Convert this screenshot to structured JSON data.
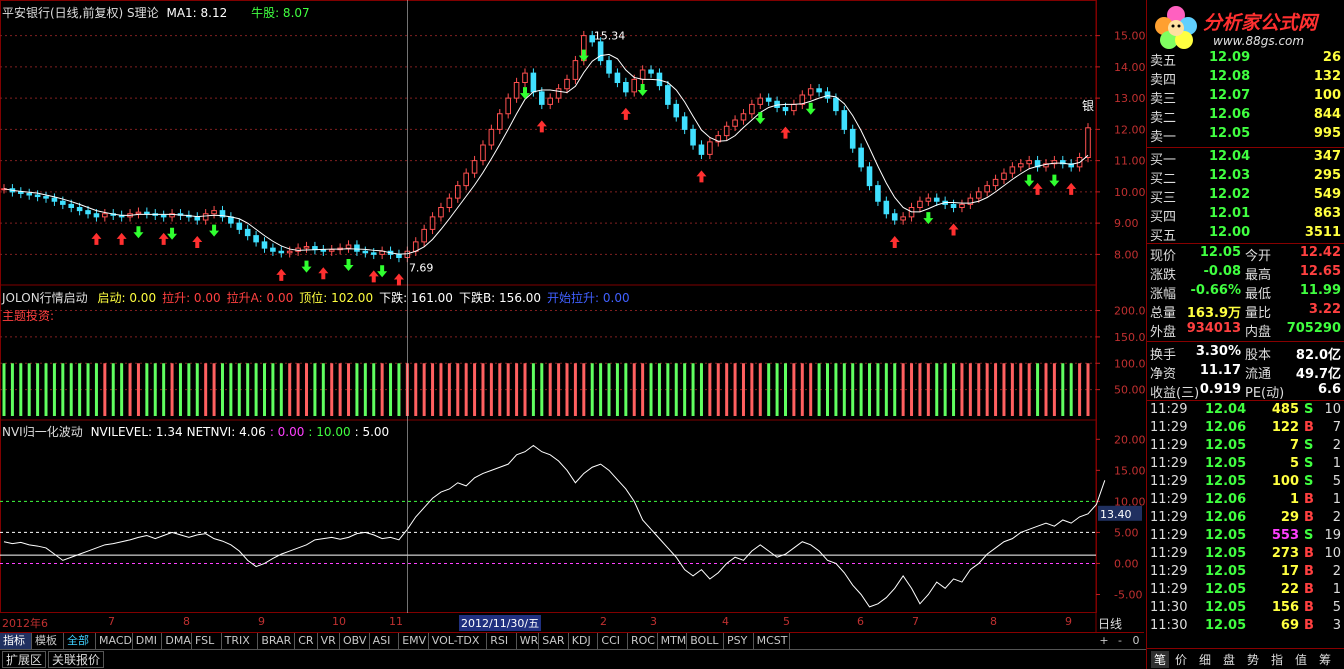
{
  "chart_header": {
    "stock": "平安银行(日线,前复权)",
    "indicator": "S理论",
    "ma_label": "MA1: 8.12",
    "bull_label": "牛股: 8.07",
    "high_label": "15.34",
    "low_label": "7.69",
    "sell_tag": "银"
  },
  "panel2_header": {
    "name": "JOLON行情启动",
    "items": [
      {
        "text": "启动: 0.00",
        "color": "#ffff40"
      },
      {
        "text": "拉升: 0.00",
        "color": "#ff4040"
      },
      {
        "text": "拉升A: 0.00",
        "color": "#ff4040"
      },
      {
        "text": "顶位: 102.00",
        "color": "#ffff40"
      },
      {
        "text": "下跌: 161.00",
        "color": "#ffffff"
      },
      {
        "text": "下跌B: 156.00",
        "color": "#ffffff"
      },
      {
        "text": "开始拉升: 0.00",
        "color": "#4060ff"
      }
    ],
    "sub": "主题投资:"
  },
  "panel3_header": {
    "name": "NVI归一化波动",
    "items": [
      {
        "text": "NVILEVEL: 1.34",
        "color": "#ffffff"
      },
      {
        "text": "NETNVI: 4.06",
        "color": "#ffffff"
      },
      {
        "text": ": 0.00",
        "color": "#ff40ff"
      },
      {
        "text": ": 10.00",
        "color": "#40ff40"
      },
      {
        "text": ": 5.00",
        "color": "#ffffff"
      }
    ],
    "current_value": "13.40"
  },
  "axis_labels": {
    "panel1": [
      "15.00",
      "14.00",
      "13.00",
      "12.00",
      "11.00",
      "10.00",
      "9.00",
      "8.00"
    ],
    "panel2": [
      "200.0",
      "150.0",
      "100.0",
      "50.00"
    ],
    "panel3": [
      "20.00",
      "15.00",
      "10.00",
      "5.00",
      "0.00",
      "-5.00"
    ]
  },
  "x_labels": [
    {
      "text": "2012年6",
      "type": "normal"
    },
    {
      "text": "7",
      "type": "normal"
    },
    {
      "text": "8",
      "type": "normal"
    },
    {
      "text": "9",
      "type": "normal"
    },
    {
      "text": "10",
      "type": "normal"
    },
    {
      "text": "11",
      "type": "normal"
    },
    {
      "text": "2012/11/30/五",
      "type": "cursor"
    },
    {
      "text": "2",
      "type": "normal"
    },
    {
      "text": "3",
      "type": "normal"
    },
    {
      "text": "4",
      "type": "normal"
    },
    {
      "text": "5",
      "type": "normal"
    },
    {
      "text": "6",
      "type": "normal"
    },
    {
      "text": "7",
      "type": "normal"
    },
    {
      "text": "8",
      "type": "normal"
    },
    {
      "text": "9",
      "type": "normal"
    }
  ],
  "period_label": "日线",
  "toolbar": [
    "指标",
    "模板",
    "全部",
    "MACD",
    "DMI",
    "DMA",
    "FSL",
    "TRIX",
    "BRAR",
    "CR",
    "VR",
    "OBV",
    "ASI",
    "EMV",
    "VOL-TDX",
    "RSI",
    "WR",
    "SAR",
    "KDJ",
    "CCI",
    "ROC",
    "MTM",
    "BOLL",
    "PSY",
    "MCST"
  ],
  "toolbar_right": [
    "+",
    "-",
    "0"
  ],
  "bottombar": [
    "扩展区",
    "关联报价"
  ],
  "logo": {
    "title": "分析家公式网",
    "url": "www.88gs.com"
  },
  "order_book": {
    "sell": [
      {
        "label": "卖五",
        "price": "12.09",
        "vol": "26"
      },
      {
        "label": "卖四",
        "price": "12.08",
        "vol": "132"
      },
      {
        "label": "卖三",
        "price": "12.07",
        "vol": "100"
      },
      {
        "label": "卖二",
        "price": "12.06",
        "vol": "844"
      },
      {
        "label": "卖一",
        "price": "12.05",
        "vol": "995"
      }
    ],
    "buy": [
      {
        "label": "买一",
        "price": "12.04",
        "vol": "347"
      },
      {
        "label": "买二",
        "price": "12.03",
        "vol": "295"
      },
      {
        "label": "买三",
        "price": "12.02",
        "vol": "549"
      },
      {
        "label": "买四",
        "price": "12.01",
        "vol": "863"
      },
      {
        "label": "买五",
        "price": "12.00",
        "vol": "3511"
      }
    ]
  },
  "quote": [
    {
      "l1": "现价",
      "v1": "12.05",
      "c1": "#40ff40",
      "l2": "今开",
      "v2": "12.42",
      "c2": "#ff4040"
    },
    {
      "l1": "涨跌",
      "v1": "-0.08",
      "c1": "#40ff40",
      "l2": "最高",
      "v2": "12.65",
      "c2": "#ff4040"
    },
    {
      "l1": "涨幅",
      "v1": "-0.66%",
      "c1": "#40ff40",
      "l2": "最低",
      "v2": "11.99",
      "c2": "#40ff40"
    },
    {
      "l1": "总量",
      "v1": "163.9万",
      "c1": "#ffff40",
      "l2": "量比",
      "v2": "3.22",
      "c2": "#ff4040"
    },
    {
      "l1": "外盘",
      "v1": "934013",
      "c1": "#ff4040",
      "l2": "内盘",
      "v2": "705290",
      "c2": "#40ff40"
    },
    {
      "l1": "换手",
      "v1": "3.30%",
      "c1": "#ffffff",
      "l2": "股本",
      "v2": "82.0亿",
      "c2": "#ffffff"
    },
    {
      "l1": "净资",
      "v1": "11.17",
      "c1": "#ffffff",
      "l2": "流通",
      "v2": "49.7亿",
      "c2": "#ffffff"
    },
    {
      "l1": "收益(三)",
      "v1": "0.919",
      "c1": "#ffffff",
      "l2": "PE(动)",
      "v2": "6.6",
      "c2": "#ffffff"
    }
  ],
  "ticks": [
    {
      "time": "11:29",
      "price": "12.04",
      "vol": "485",
      "side": "S",
      "cnt": "10",
      "vc": "#ffff40"
    },
    {
      "time": "11:29",
      "price": "12.06",
      "vol": "122",
      "side": "B",
      "cnt": "7",
      "vc": "#ffff40"
    },
    {
      "time": "11:29",
      "price": "12.05",
      "vol": "7",
      "side": "S",
      "cnt": "2",
      "vc": "#ffff40"
    },
    {
      "time": "11:29",
      "price": "12.05",
      "vol": "5",
      "side": "S",
      "cnt": "1",
      "vc": "#ffff40"
    },
    {
      "time": "11:29",
      "price": "12.05",
      "vol": "100",
      "side": "S",
      "cnt": "5",
      "vc": "#ffff40"
    },
    {
      "time": "11:29",
      "price": "12.06",
      "vol": "1",
      "side": "B",
      "cnt": "1",
      "vc": "#ffff40"
    },
    {
      "time": "11:29",
      "price": "12.06",
      "vol": "29",
      "side": "B",
      "cnt": "2",
      "vc": "#ffff40"
    },
    {
      "time": "11:29",
      "price": "12.05",
      "vol": "553",
      "side": "S",
      "cnt": "19",
      "vc": "#ff40ff"
    },
    {
      "time": "11:29",
      "price": "12.05",
      "vol": "273",
      "side": "B",
      "cnt": "10",
      "vc": "#ffff40"
    },
    {
      "time": "11:29",
      "price": "12.05",
      "vol": "17",
      "side": "B",
      "cnt": "2",
      "vc": "#ffff40"
    },
    {
      "time": "11:29",
      "price": "12.05",
      "vol": "22",
      "side": "B",
      "cnt": "1",
      "vc": "#ffff40"
    },
    {
      "time": "11:30",
      "price": "12.05",
      "vol": "156",
      "side": "B",
      "cnt": "5",
      "vc": "#ffff40"
    },
    {
      "time": "11:30",
      "price": "12.05",
      "vol": "69",
      "side": "B",
      "cnt": "3",
      "vc": "#ffff40"
    }
  ],
  "right_tabs": [
    "笔",
    "价",
    "细",
    "盘",
    "势",
    "指",
    "值",
    "筹"
  ],
  "chart_data": {
    "type": "line",
    "title": "平安银行(日线,前复权)",
    "price_ylim": [
      7.5,
      15.5
    ],
    "price_close": [
      10.1,
      10.0,
      9.95,
      9.9,
      9.85,
      9.8,
      9.7,
      9.6,
      9.5,
      9.4,
      9.3,
      9.2,
      9.3,
      9.25,
      9.2,
      9.3,
      9.35,
      9.3,
      9.25,
      9.2,
      9.3,
      9.25,
      9.2,
      9.1,
      9.3,
      9.4,
      9.2,
      9.0,
      8.8,
      8.6,
      8.4,
      8.2,
      8.1,
      8.05,
      8.1,
      8.2,
      8.25,
      8.15,
      8.1,
      8.15,
      8.2,
      8.3,
      8.1,
      8.05,
      8.0,
      8.1,
      8.0,
      7.9,
      8.1,
      8.4,
      8.8,
      9.2,
      9.5,
      9.8,
      10.2,
      10.6,
      11.0,
      11.5,
      12.0,
      12.5,
      13.0,
      13.5,
      13.8,
      13.2,
      12.8,
      13.0,
      13.3,
      13.6,
      14.2,
      15.0,
      14.8,
      14.2,
      13.8,
      13.5,
      13.2,
      13.6,
      13.9,
      13.8,
      13.4,
      12.8,
      12.4,
      12.0,
      11.5,
      11.2,
      11.6,
      11.8,
      12.1,
      12.3,
      12.5,
      12.8,
      13.0,
      12.9,
      12.7,
      12.6,
      12.8,
      13.1,
      13.3,
      13.2,
      13.0,
      12.6,
      12.0,
      11.4,
      10.8,
      10.2,
      9.7,
      9.3,
      9.1,
      9.2,
      9.5,
      9.7,
      9.8,
      9.7,
      9.6,
      9.5,
      9.6,
      9.8,
      10.0,
      10.2,
      10.4,
      10.6,
      10.8,
      10.9,
      11.0,
      10.8,
      10.9,
      11.0,
      10.9,
      10.8,
      11.1,
      12.05
    ],
    "nvi_ylim": [
      -7.5,
      21.5
    ],
    "nvi": [
      3.5,
      3.2,
      3.4,
      3.0,
      2.8,
      2.5,
      1.5,
      0.5,
      1.0,
      1.5,
      2.0,
      2.5,
      3.0,
      3.2,
      3.5,
      3.8,
      4.2,
      4.5,
      4.0,
      4.5,
      5.0,
      4.6,
      4.2,
      4.6,
      4.8,
      4.0,
      3.6,
      3.0,
      2.0,
      0.5,
      -0.5,
      0.0,
      0.8,
      1.5,
      2.0,
      2.5,
      3.0,
      3.8,
      4.0,
      4.2,
      3.9,
      4.2,
      4.8,
      5.0,
      4.6,
      4.0,
      4.2,
      3.8,
      5.5,
      7.5,
      9.0,
      10.5,
      11.5,
      12.0,
      13.0,
      12.5,
      13.8,
      14.5,
      15.0,
      15.5,
      16.0,
      17.5,
      18.0,
      19.0,
      18.0,
      17.5,
      16.5,
      15.0,
      13.0,
      14.5,
      15.5,
      16.0,
      15.0,
      13.5,
      12.0,
      10.0,
      7.0,
      5.5,
      4.0,
      2.5,
      1.0,
      -1.0,
      -2.0,
      -1.0,
      -2.5,
      -1.5,
      0.0,
      1.0,
      0.5,
      2.0,
      3.0,
      2.0,
      1.0,
      1.5,
      2.5,
      3.5,
      3.0,
      2.0,
      0.5,
      0.0,
      -1.5,
      -3.5,
      -5.0,
      -7.0,
      -6.5,
      -5.5,
      -4.0,
      -2.0,
      -4.0,
      -6.5,
      -5.0,
      -3.0,
      -4.0,
      -2.5,
      -3.0,
      -1.0,
      0.0,
      1.5,
      2.5,
      3.5,
      4.0,
      5.0,
      5.5,
      6.0,
      6.5,
      6.0,
      7.0,
      6.5,
      7.5,
      8.0,
      9.5,
      13.4
    ],
    "nvi_levels": {
      "level0": 0.0,
      "level1": 1.34,
      "level5": 5.0,
      "level10": 10.0
    }
  }
}
